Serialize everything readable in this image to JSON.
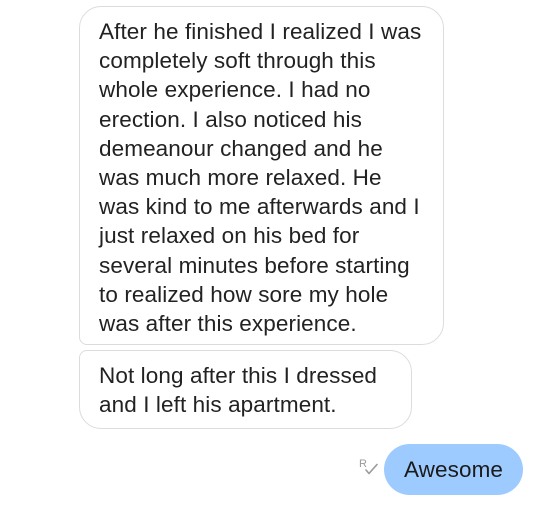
{
  "messages": [
    {
      "direction": "incoming",
      "text": "After he finished I realized I was completely soft through this whole experience. I had no erection. I also noticed his demeanour changed and he was much more relaxed. He was kind to me afterwards and I just relaxed on his bed for several minutes before starting to realized how sore my hole was after this experience."
    },
    {
      "direction": "incoming",
      "text": "Not long after this I dressed and I left his apartment."
    },
    {
      "direction": "outgoing",
      "text": "Awesome",
      "status_icon": "read-receipt-icon"
    }
  ],
  "colors": {
    "incoming_bubble_bg": "#ffffff",
    "incoming_bubble_border": "#dcdcdc",
    "outgoing_bubble_bg": "#9ecbff",
    "text": "#222222",
    "receipt_icon": "#9a9a9a"
  }
}
